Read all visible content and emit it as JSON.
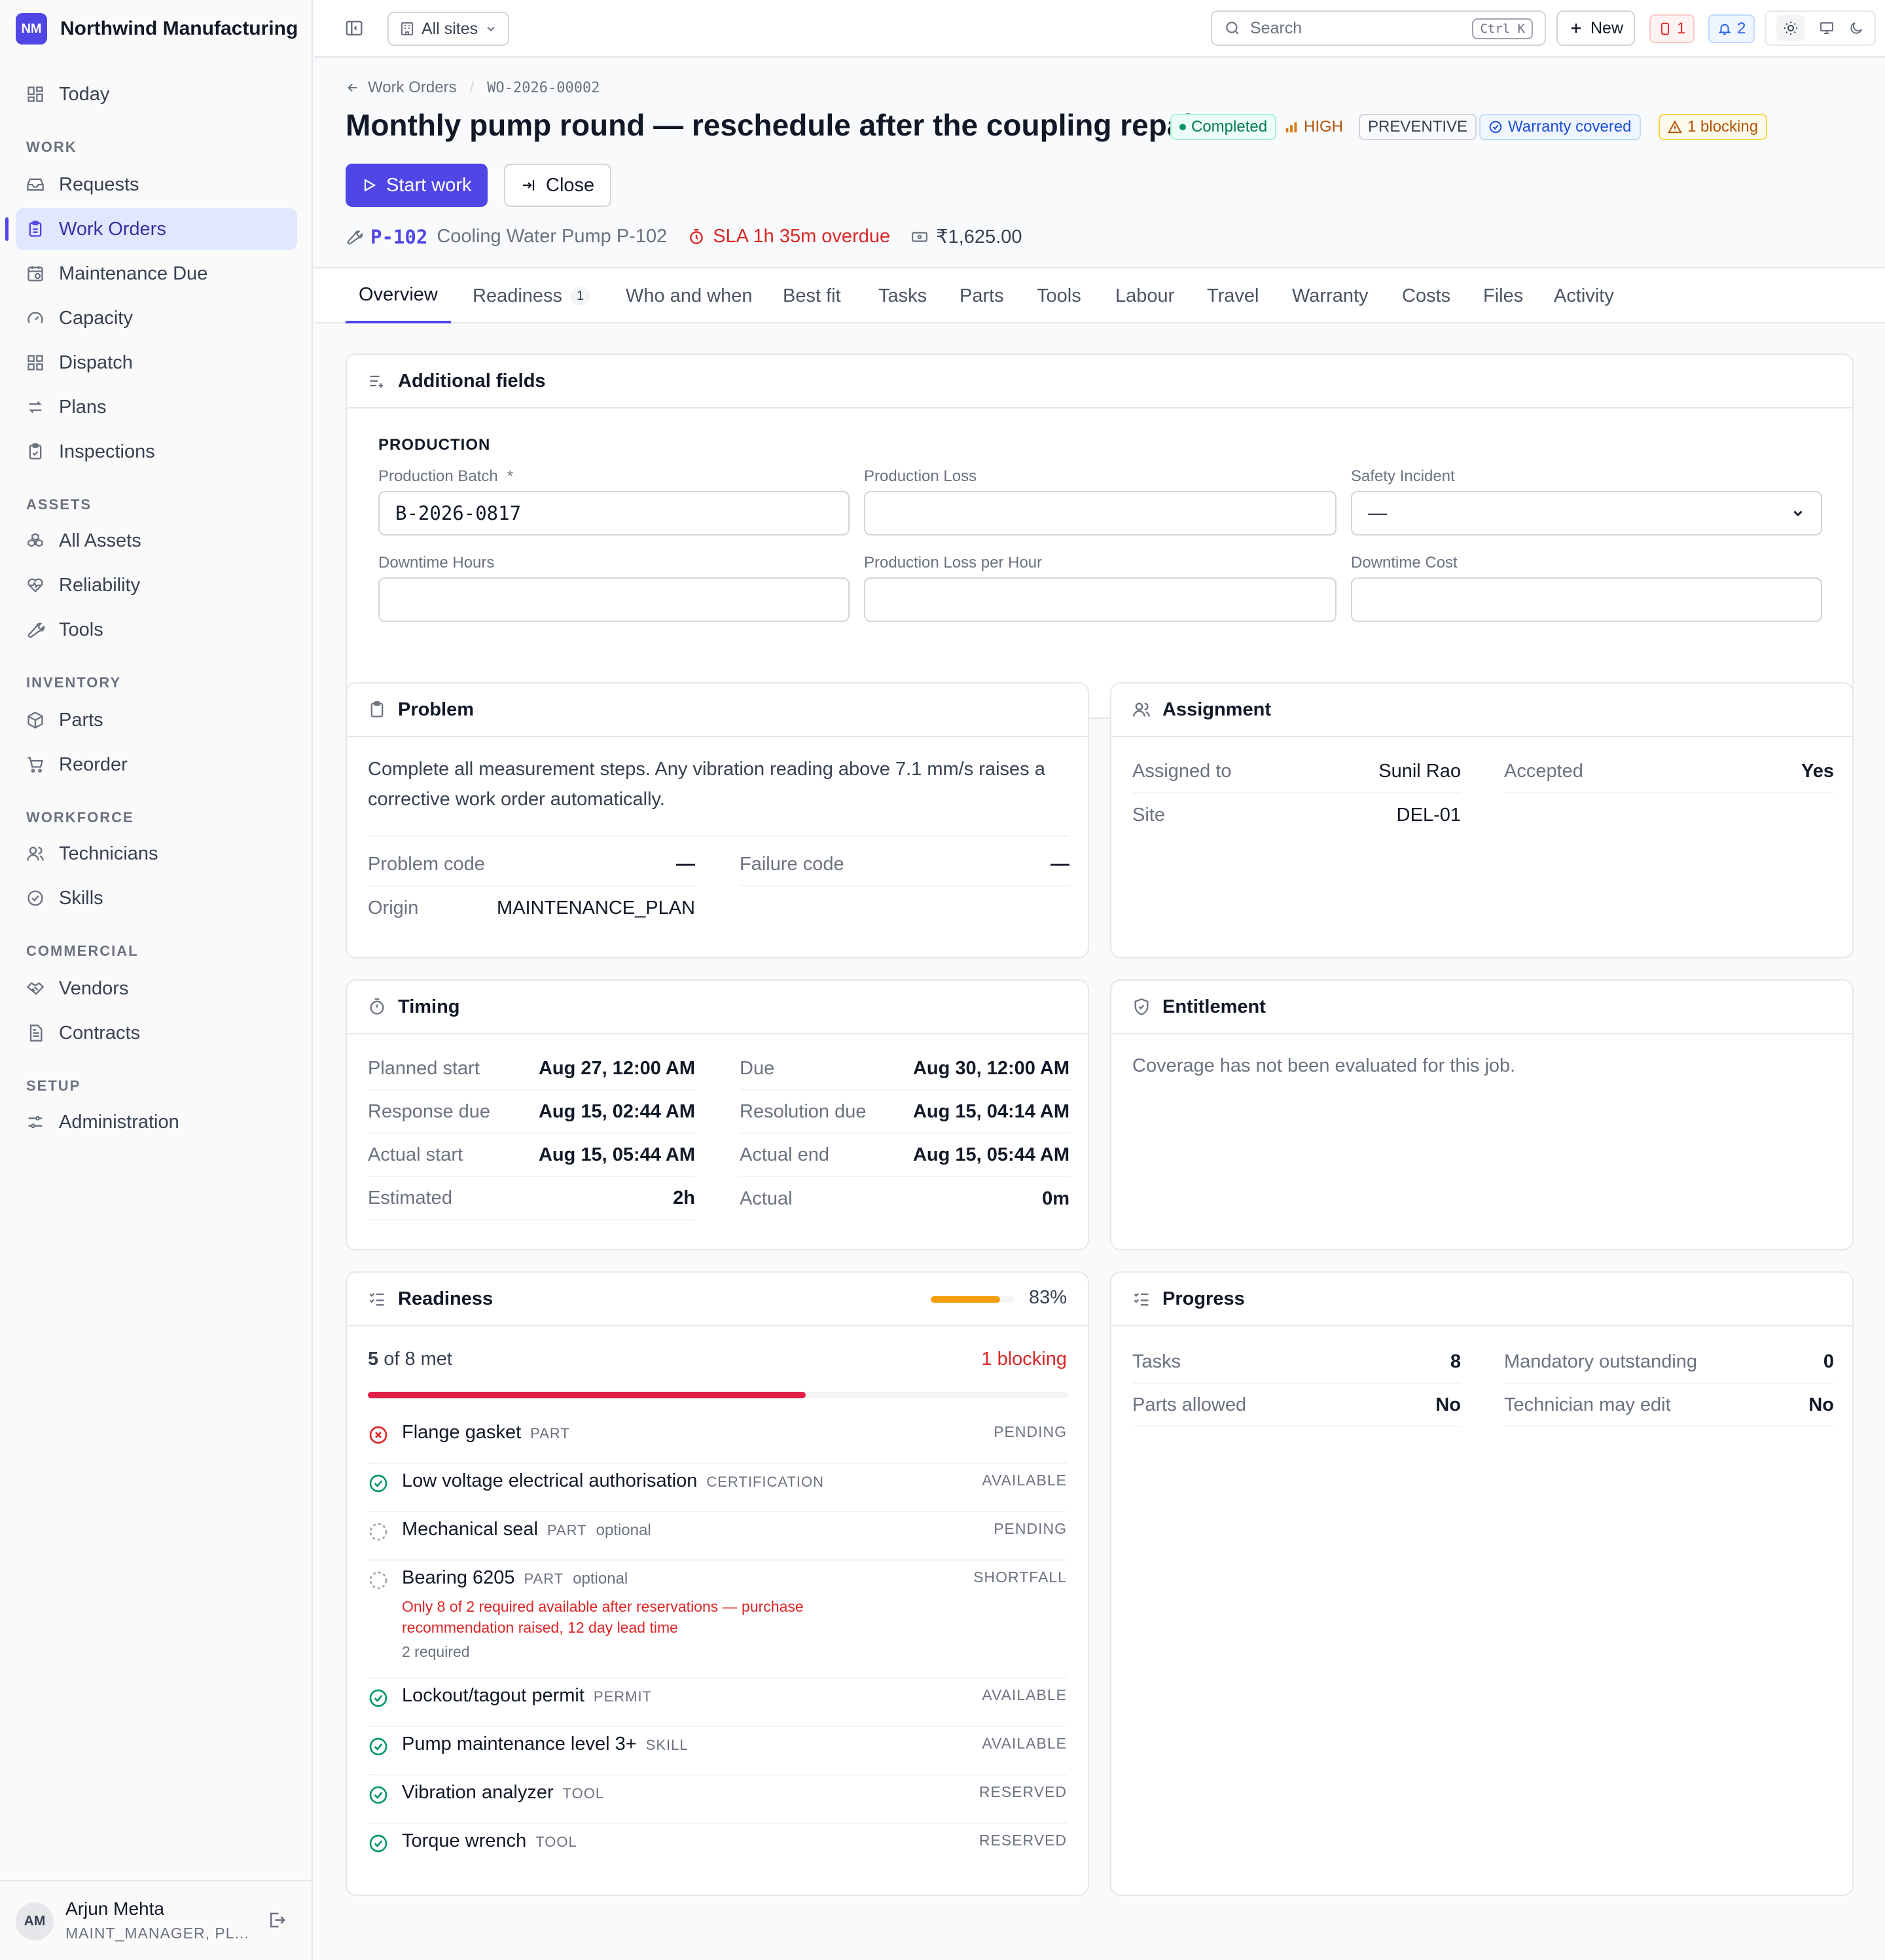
{
  "brand": {
    "initials": "NM",
    "name": "Northwind Manufacturing"
  },
  "sidebar": {
    "today": "Today",
    "sections": {
      "work": "WORK",
      "assets": "ASSETS",
      "inventory": "INVENTORY",
      "workforce": "WORKFORCE",
      "commercial": "COMMERCIAL",
      "setup": "SETUP"
    },
    "items": {
      "requests": "Requests",
      "work_orders": "Work Orders",
      "maintenance_due": "Maintenance Due",
      "capacity": "Capacity",
      "dispatch": "Dispatch",
      "plans": "Plans",
      "inspections": "Inspections",
      "all_assets": "All Assets",
      "reliability": "Reliability",
      "tools": "Tools",
      "parts": "Parts",
      "reorder": "Reorder",
      "technicians": "Technicians",
      "skills": "Skills",
      "vendors": "Vendors",
      "contracts": "Contracts",
      "administration": "Administration"
    },
    "user": {
      "initials": "AM",
      "name": "Arjun Mehta",
      "role": "MAINT_MANAGER, PL..."
    }
  },
  "topbar": {
    "site_selector": "All sites",
    "search_placeholder": "Search",
    "search_shortcut": "Ctrl K",
    "new_label": "New",
    "alerts_count": "1",
    "notifications_count": "2"
  },
  "work_order": {
    "breadcrumb_parent": "Work Orders",
    "breadcrumb_sep": "/",
    "breadcrumb_id": "WO-2026-00002",
    "title": "Monthly pump round — reschedule after the coupling repair",
    "status": "Completed",
    "priority": "HIGH",
    "type": "PREVENTIVE",
    "warranty": "Warranty covered",
    "blocking": "1 blocking",
    "start_label": "Start work",
    "close_label": "Close",
    "asset_code": "P-102",
    "asset_name": "Cooling Water Pump P-102",
    "sla": "SLA 1h 35m overdue",
    "cost": "₹1,625.00"
  },
  "tabs": [
    {
      "label": "Overview"
    },
    {
      "label": "Readiness",
      "count": "1"
    },
    {
      "label": "Who and when"
    },
    {
      "label": "Best fit"
    },
    {
      "label": "Tasks"
    },
    {
      "label": "Parts"
    },
    {
      "label": "Tools"
    },
    {
      "label": "Labour"
    },
    {
      "label": "Travel"
    },
    {
      "label": "Warranty"
    },
    {
      "label": "Costs"
    },
    {
      "label": "Files"
    },
    {
      "label": "Activity"
    }
  ],
  "additional_fields": {
    "title": "Additional fields",
    "section": "PRODUCTION",
    "production_batch_label": "Production Batch",
    "required_mark": "*",
    "production_batch_value": "B-2026-0817",
    "production_loss_label": "Production Loss",
    "safety_incident_label": "Safety Incident",
    "safety_incident_value": "—",
    "downtime_hours_label": "Downtime Hours",
    "production_loss_per_hour_label": "Production Loss per Hour",
    "downtime_cost_label": "Downtime Cost"
  },
  "problem": {
    "title": "Problem",
    "description": "Complete all measurement steps. Any vibration reading above 7.1 mm/s raises a corrective work order automatically.",
    "problem_code_label": "Problem code",
    "problem_code_value": "—",
    "failure_code_label": "Failure code",
    "failure_code_value": "—",
    "origin_label": "Origin",
    "origin_value": "MAINTENANCE_PLAN"
  },
  "assignment": {
    "title": "Assignment",
    "assigned_to_label": "Assigned to",
    "assigned_to_value": "Sunil Rao",
    "accepted_label": "Accepted",
    "accepted_value": "Yes",
    "site_label": "Site",
    "site_value": "DEL-01"
  },
  "timing": {
    "title": "Timing",
    "planned_start_label": "Planned start",
    "planned_start_value": "Aug 27, 12:00 AM",
    "due_label": "Due",
    "due_value": "Aug 30, 12:00 AM",
    "response_due_label": "Response due",
    "response_due_value": "Aug 15, 02:44 AM",
    "resolution_due_label": "Resolution due",
    "resolution_due_value": "Aug 15, 04:14 AM",
    "actual_start_label": "Actual start",
    "actual_start_value": "Aug 15, 05:44 AM",
    "actual_end_label": "Actual end",
    "actual_end_value": "Aug 15, 05:44 AM",
    "estimated_label": "Estimated",
    "estimated_value": "2h",
    "actual_label": "Actual",
    "actual_value": "0m"
  },
  "entitlement": {
    "title": "Entitlement",
    "message": "Coverage has not been evaluated for this job."
  },
  "readiness": {
    "title": "Readiness",
    "percent_label": "83%",
    "percent": 0.83,
    "met_count": "5",
    "met_text": "of 8 met",
    "blocking": "1 blocking",
    "met_fraction": 0.625,
    "items": [
      {
        "name": "Flange gasket",
        "type": "PART",
        "optional": "",
        "status": "PENDING",
        "icon": "x-circle-icon"
      },
      {
        "name": "Low voltage electrical authorisation",
        "type": "CERTIFICATION",
        "optional": "",
        "status": "AVAILABLE",
        "icon": "check-circle-icon"
      },
      {
        "name": "Mechanical seal",
        "type": "PART",
        "optional": "optional",
        "status": "PENDING",
        "icon": "dashed-circle-icon"
      },
      {
        "name": "Bearing 6205",
        "type": "PART",
        "optional": "optional",
        "status": "SHORTFALL",
        "icon": "dashed-circle-icon",
        "note": "Only 8 of 2 required available after reservations — purchase recommendation raised, 12 day lead time",
        "required": "2 required"
      },
      {
        "name": "Lockout/tagout permit",
        "type": "PERMIT",
        "optional": "",
        "status": "AVAILABLE",
        "icon": "check-circle-icon"
      },
      {
        "name": "Pump maintenance level 3+",
        "type": "SKILL",
        "optional": "",
        "status": "AVAILABLE",
        "icon": "check-circle-icon"
      },
      {
        "name": "Vibration analyzer",
        "type": "TOOL",
        "optional": "",
        "status": "RESERVED",
        "icon": "check-circle-icon"
      },
      {
        "name": "Torque wrench",
        "type": "TOOL",
        "optional": "",
        "status": "RESERVED",
        "icon": "check-circle-icon"
      }
    ]
  },
  "progress": {
    "title": "Progress",
    "tasks_label": "Tasks",
    "tasks_value": "8",
    "mandatory_label": "Mandatory outstanding",
    "mandatory_value": "0",
    "parts_allowed_label": "Parts allowed",
    "parts_allowed_value": "No",
    "tech_edit_label": "Technician may edit",
    "tech_edit_value": "No"
  },
  "colors": {
    "accent": "#4f46e5",
    "danger": "#dc2626",
    "success": "#059669",
    "warning": "#f59e0b"
  }
}
